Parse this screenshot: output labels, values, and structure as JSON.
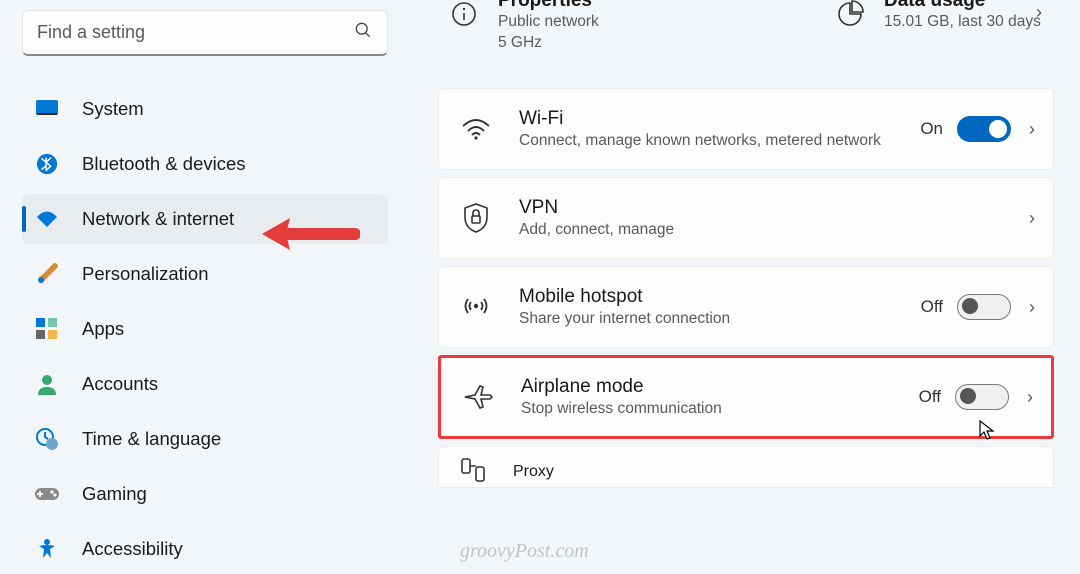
{
  "search": {
    "placeholder": "Find a setting"
  },
  "sidebar": {
    "items": [
      {
        "label": "System"
      },
      {
        "label": "Bluetooth & devices"
      },
      {
        "label": "Network & internet",
        "selected": true
      },
      {
        "label": "Personalization"
      },
      {
        "label": "Apps"
      },
      {
        "label": "Accounts"
      },
      {
        "label": "Time & language"
      },
      {
        "label": "Gaming"
      },
      {
        "label": "Accessibility"
      }
    ]
  },
  "top": {
    "properties": {
      "title": "Properties",
      "sub1": "Public network",
      "sub2": "5 GHz"
    },
    "data_usage": {
      "title": "Data usage",
      "sub": "15.01 GB, last 30 days"
    }
  },
  "cards": {
    "wifi": {
      "title": "Wi-Fi",
      "sub": "Connect, manage known networks, metered network",
      "state": "On"
    },
    "vpn": {
      "title": "VPN",
      "sub": "Add, connect, manage"
    },
    "hotspot": {
      "title": "Mobile hotspot",
      "sub": "Share your internet connection",
      "state": "Off"
    },
    "airplane": {
      "title": "Airplane mode",
      "sub": "Stop wireless communication",
      "state": "Off"
    },
    "proxy": {
      "title": "Proxy"
    }
  },
  "watermark": "groovyPost.com"
}
